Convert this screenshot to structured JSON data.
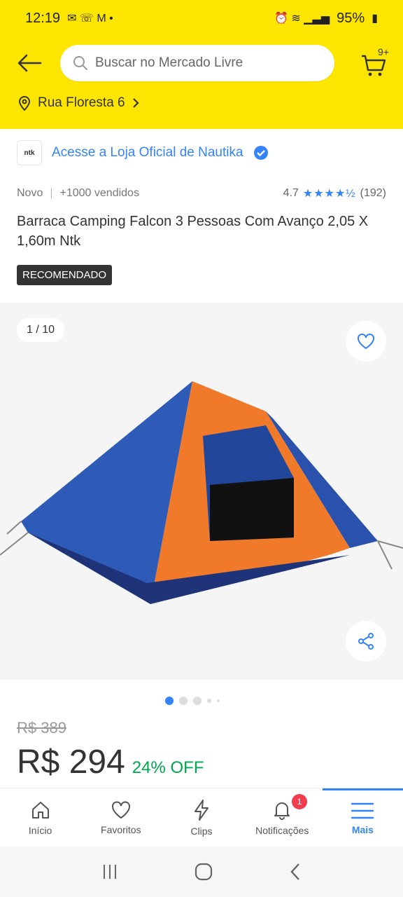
{
  "status_bar": {
    "time": "12:19",
    "battery": "95%"
  },
  "header": {
    "search_placeholder": "Buscar no Mercado Livre",
    "cart_count": "9+",
    "address": "Rua Floresta 6"
  },
  "store": {
    "logo_text": "ntk",
    "link": "Acesse a Loja Oficial de Nautika"
  },
  "product": {
    "condition": "Novo",
    "sold": "+1000 vendidos",
    "rating": "4.7",
    "rating_count": "(192)",
    "title": "Barraca Camping Falcon 3 Pessoas Com Avanço 2,05 X 1,60m Ntk",
    "badge": "RECOMENDADO",
    "gallery_counter": "1 / 10",
    "old_price": "R$ 389",
    "price": "R$ 294",
    "discount": "24% OFF"
  },
  "nav": {
    "items": [
      {
        "label": "Início",
        "icon": "home-icon"
      },
      {
        "label": "Favoritos",
        "icon": "heart-icon"
      },
      {
        "label": "Clips",
        "icon": "lightning-icon"
      },
      {
        "label": "Notificações",
        "icon": "bell-icon",
        "badge": "1"
      },
      {
        "label": "Mais",
        "icon": "menu-icon"
      }
    ]
  },
  "colors": {
    "brand_yellow": "#ffe600",
    "link_blue": "#3483fa",
    "discount_green": "#00a650"
  }
}
